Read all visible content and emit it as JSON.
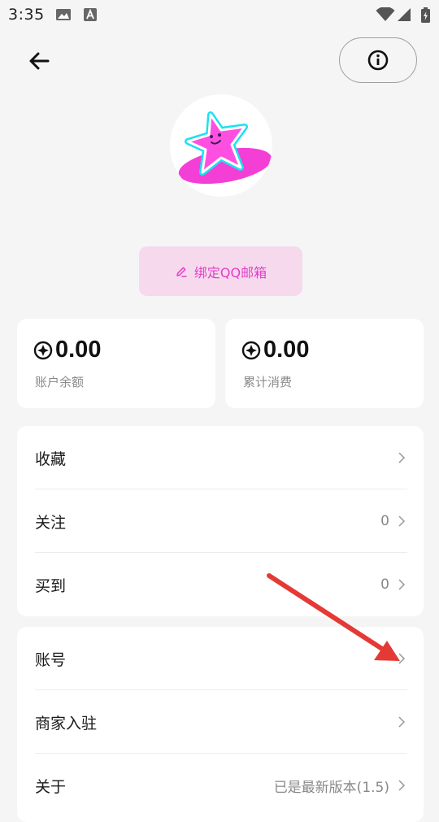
{
  "status_bar": {
    "time": "3:35"
  },
  "bind_email": {
    "label": "绑定QQ邮箱"
  },
  "balance": {
    "account": {
      "amount": "0.00",
      "label": "账户余额"
    },
    "spent": {
      "amount": "0.00",
      "label": "累计消费"
    }
  },
  "menu_group_1": [
    {
      "label": "收藏",
      "value": ""
    },
    {
      "label": "关注",
      "value": "0"
    },
    {
      "label": "买到",
      "value": "0"
    }
  ],
  "menu_group_2": [
    {
      "label": "账号",
      "value": ""
    },
    {
      "label": "商家入驻",
      "value": ""
    },
    {
      "label": "关于",
      "value": "已是最新版本(1.5)"
    }
  ],
  "colors": {
    "accent_pink": "#e23fc6",
    "bind_bg": "#f7d9ee",
    "annotation_arrow": "#e53935"
  },
  "icons": [
    "back-arrow-icon",
    "info-icon",
    "edit-icon",
    "coin-icon",
    "chevron-right-icon"
  ]
}
